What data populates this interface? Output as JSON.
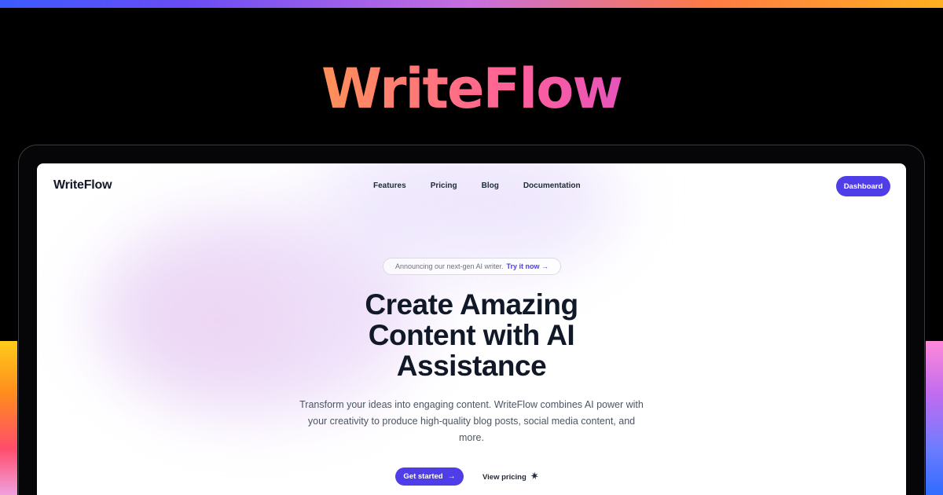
{
  "banner": {
    "title": "WriteFlow"
  },
  "nav": {
    "logo": "WriteFlow",
    "links": [
      "Features",
      "Pricing",
      "Blog",
      "Documentation"
    ],
    "dashboard_label": "Dashboard"
  },
  "hero": {
    "announcement_text": "Announcing our next-gen AI writer.",
    "announcement_link": "Try it now →",
    "headline_lines": [
      "Create Amazing",
      "Content with AI",
      "Assistance"
    ],
    "subtext": "Transform your ideas into engaging content. WriteFlow combines AI power with your creativity to produce high-quality blog posts, social media content, and more.",
    "primary_cta": "Get started",
    "secondary_cta": "View pricing"
  },
  "icons": {
    "primary_cta_icon": "arrow-right-icon",
    "secondary_cta_icon": "sparkle-icon"
  },
  "colors": {
    "accent": "#4f3de8",
    "text_dark": "#111827",
    "background": "#000000"
  }
}
